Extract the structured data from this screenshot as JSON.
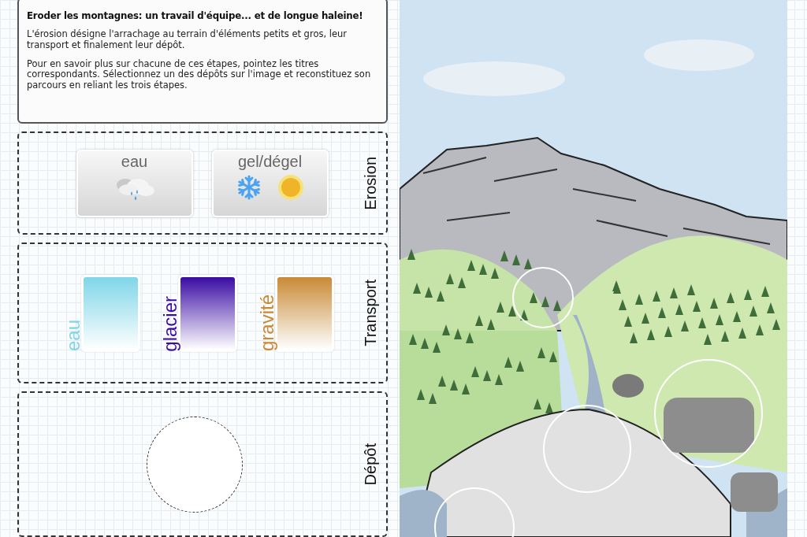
{
  "intro": {
    "title": "Eroder les montagnes: un travail d'équipe... et de longue haleine!",
    "paragraphs": [
      "L'érosion désigne l'arrachage au terrain d'éléments petits et gros, leur transport et finalement leur dépôt.",
      "Pour en savoir plus sur chacune de ces étapes, pointez les titres correspondants. Sélectionnez un des dépôts sur l'image et reconstituez son parcours en reliant les trois étapes."
    ]
  },
  "erosion": {
    "label": "Erosion",
    "cards": [
      {
        "label": "eau",
        "kind": "rain"
      },
      {
        "label": "gel/dégel",
        "kind": "freeze-thaw"
      }
    ]
  },
  "transport": {
    "label": "Transport",
    "agents": [
      {
        "label": "eau",
        "color": "#7fd6e8"
      },
      {
        "label": "glacier",
        "color": "#3a0ca3"
      },
      {
        "label": "gravité",
        "color": "#c98a35"
      }
    ]
  },
  "deposit": {
    "label": "Dépôt"
  }
}
